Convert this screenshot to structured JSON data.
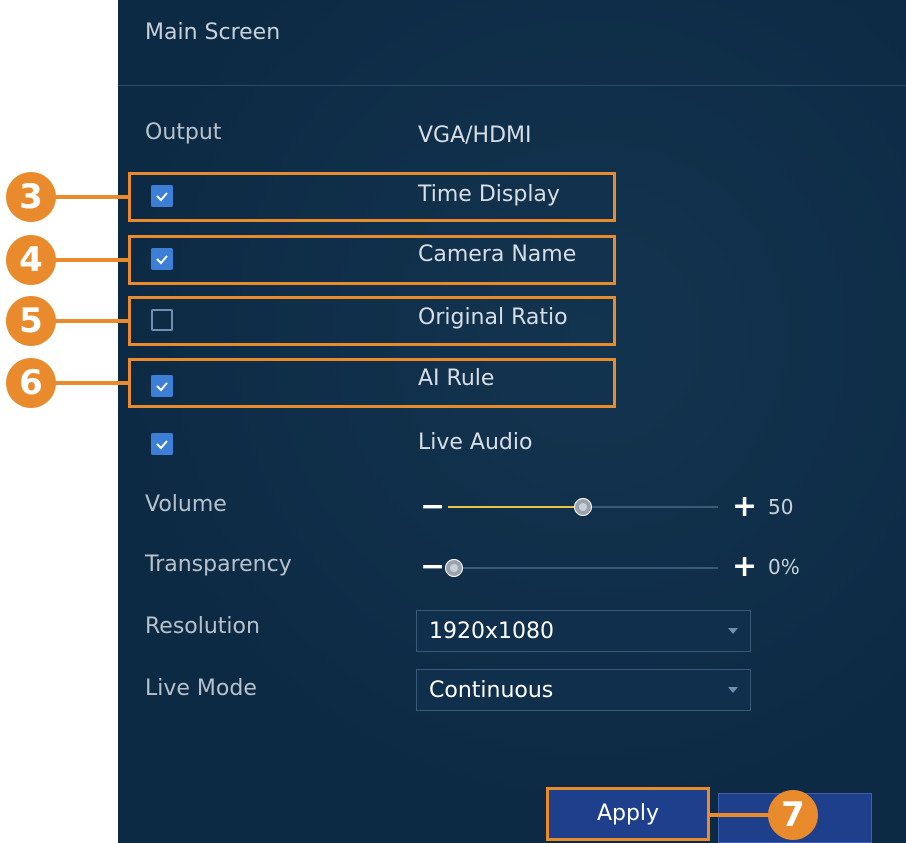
{
  "header": {
    "title": "Main Screen"
  },
  "output": {
    "label": "Output",
    "value": "VGA/HDMI"
  },
  "options": [
    {
      "label": "Time Display",
      "checked": true,
      "callout": "3"
    },
    {
      "label": "Camera Name",
      "checked": true,
      "callout": "4"
    },
    {
      "label": "Original Ratio",
      "checked": false,
      "callout": "5"
    },
    {
      "label": "AI Rule",
      "checked": true,
      "callout": "6"
    },
    {
      "label": "Live Audio",
      "checked": true,
      "callout": ""
    }
  ],
  "volume": {
    "label": "Volume",
    "minus": "−",
    "plus": "+",
    "value_text": "50",
    "level": 0.5
  },
  "transparency": {
    "label": "Transparency",
    "minus": "−",
    "plus": "+",
    "value_text": "0%",
    "level": 0.0
  },
  "resolution": {
    "label": "Resolution",
    "selected": "1920x1080"
  },
  "live_mode": {
    "label": "Live Mode",
    "selected": "Continuous"
  },
  "footer": {
    "apply_label": "Apply",
    "apply_callout": "7"
  },
  "colors": {
    "accent_orange": "#e98a2d",
    "panel_bg": "#0d2a44",
    "checkbox_blue": "#3d7fd6",
    "slider_fill": "#e8c547"
  }
}
